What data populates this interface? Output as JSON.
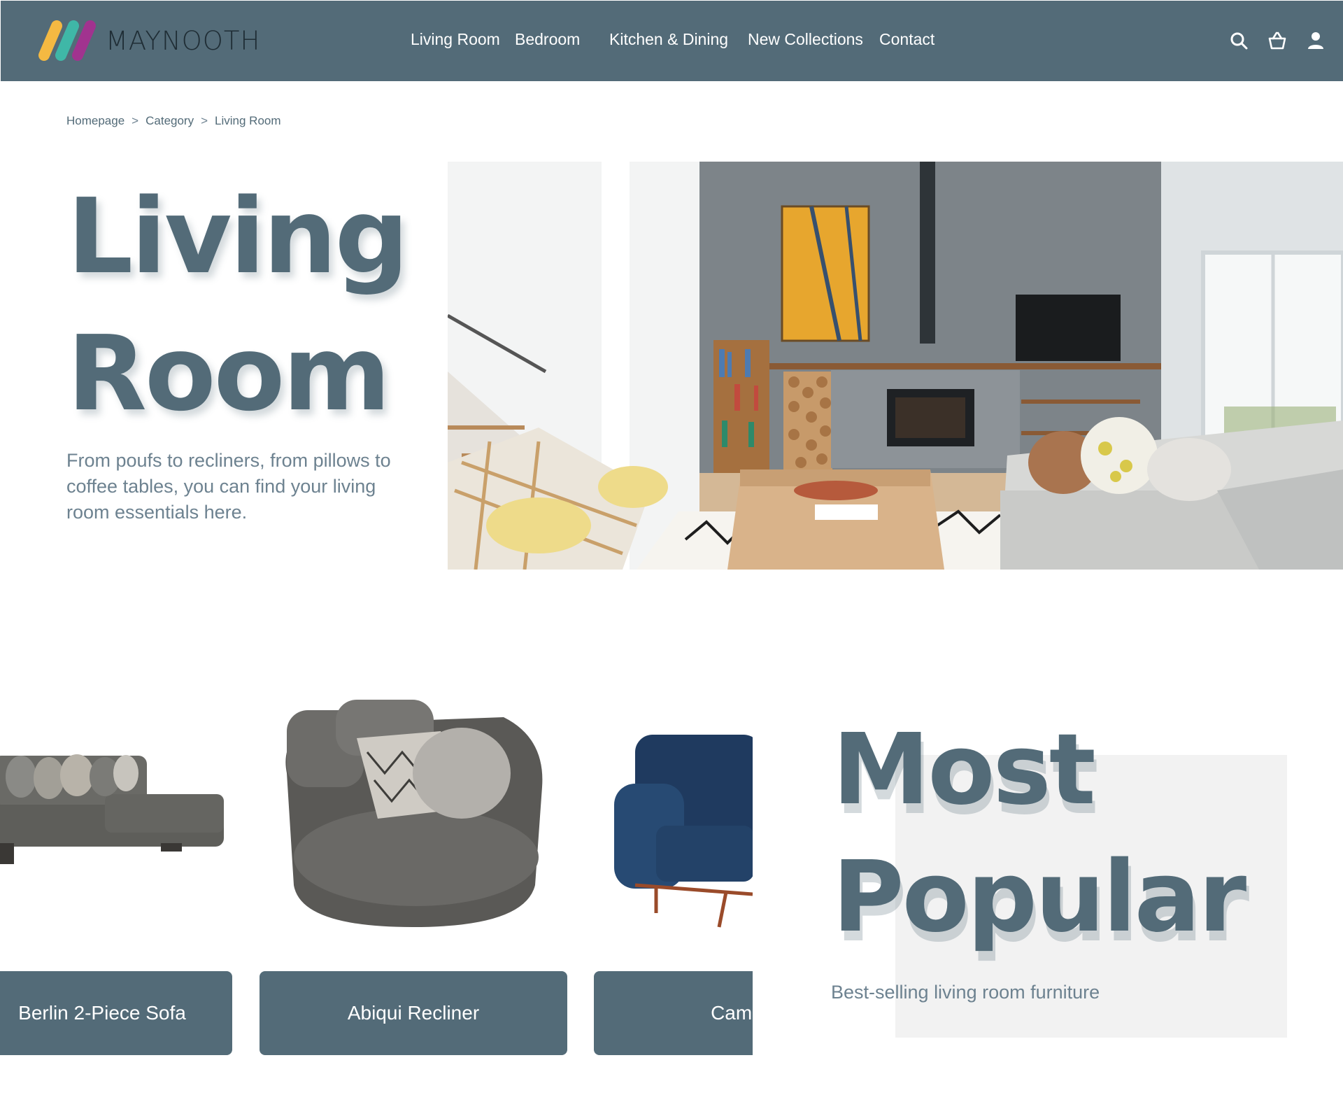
{
  "brand": {
    "name": "MAYNOOTH"
  },
  "nav": {
    "items": [
      {
        "label": "Living Room"
      },
      {
        "label": "Bedroom"
      },
      {
        "label": "Kitchen & Dining"
      },
      {
        "label": "New Collections"
      },
      {
        "label": "Contact"
      }
    ],
    "icons": [
      "search-icon",
      "basket-icon",
      "user-icon"
    ]
  },
  "breadcrumb": {
    "items": [
      "Homepage",
      "Category",
      "Living Room"
    ],
    "separator": ">"
  },
  "hero": {
    "title_line1": "Living",
    "title_line2": "Room",
    "description": "From poufs to recliners, from pillows to coffee tables, you can find your living room essentials here."
  },
  "products": [
    {
      "name": "Berlin 2-Piece Sofa"
    },
    {
      "name": "Abiqui Recliner"
    },
    {
      "name": "Camden"
    }
  ],
  "most_popular": {
    "title_line1": "Most",
    "title_line2": "Popular",
    "subtitle": "Best-selling living room furniture"
  },
  "colors": {
    "primary": "#536b78",
    "accent_yellow": "#f4b942",
    "accent_teal": "#3fb7a7",
    "accent_magenta": "#a1338f"
  }
}
